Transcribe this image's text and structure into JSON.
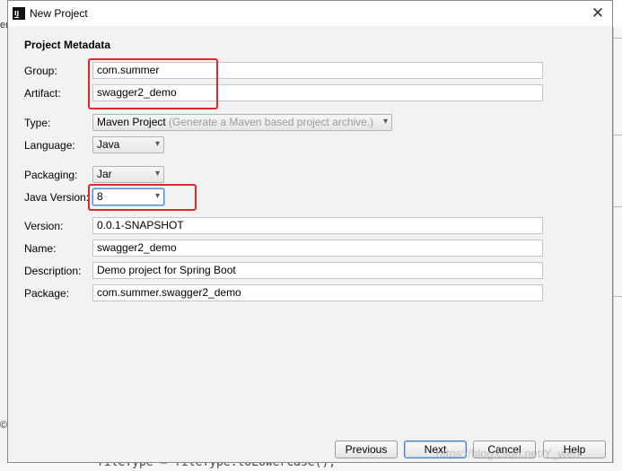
{
  "background": {
    "left_char": "er",
    "left_char2": "©",
    "code_line": "fileType = fileType.toLowerCase();"
  },
  "dialog": {
    "title": "New Project",
    "section_title": "Project Metadata"
  },
  "fields": {
    "group": {
      "label": "Group:",
      "value": "com.summer"
    },
    "artifact": {
      "label": "Artifact:",
      "value": "swagger2_demo"
    },
    "version": {
      "label": "Version:",
      "value": "0.0.1-SNAPSHOT"
    },
    "name": {
      "label": "Name:",
      "value": "swagger2_demo"
    },
    "description": {
      "label": "Description:",
      "value": "Demo project for Spring Boot"
    },
    "package": {
      "label": "Package:",
      "value": "com.summer.swagger2_demo"
    }
  },
  "combos": {
    "type": {
      "label": "Type:",
      "value": "Maven Project",
      "hint": "(Generate a Maven based project archive.)"
    },
    "language": {
      "label": "Language:",
      "value": "Java"
    },
    "packaging": {
      "label": "Packaging:",
      "value": "Jar"
    },
    "java_version": {
      "label": "Java Version:",
      "value": "8"
    }
  },
  "buttons": {
    "previous": "Previous",
    "next": "Next",
    "cancel": "Cancel",
    "help": "Help"
  },
  "watermark": "https://blog.csdn.net/Y_wen",
  "icons": {
    "app": "intellij-icon",
    "close": "close-icon",
    "dropdown": "chevron-down-icon"
  },
  "colors": {
    "highlight": "#e02a2a",
    "dialog_bg": "#f2f2f2",
    "focus": "#4a90d9"
  }
}
